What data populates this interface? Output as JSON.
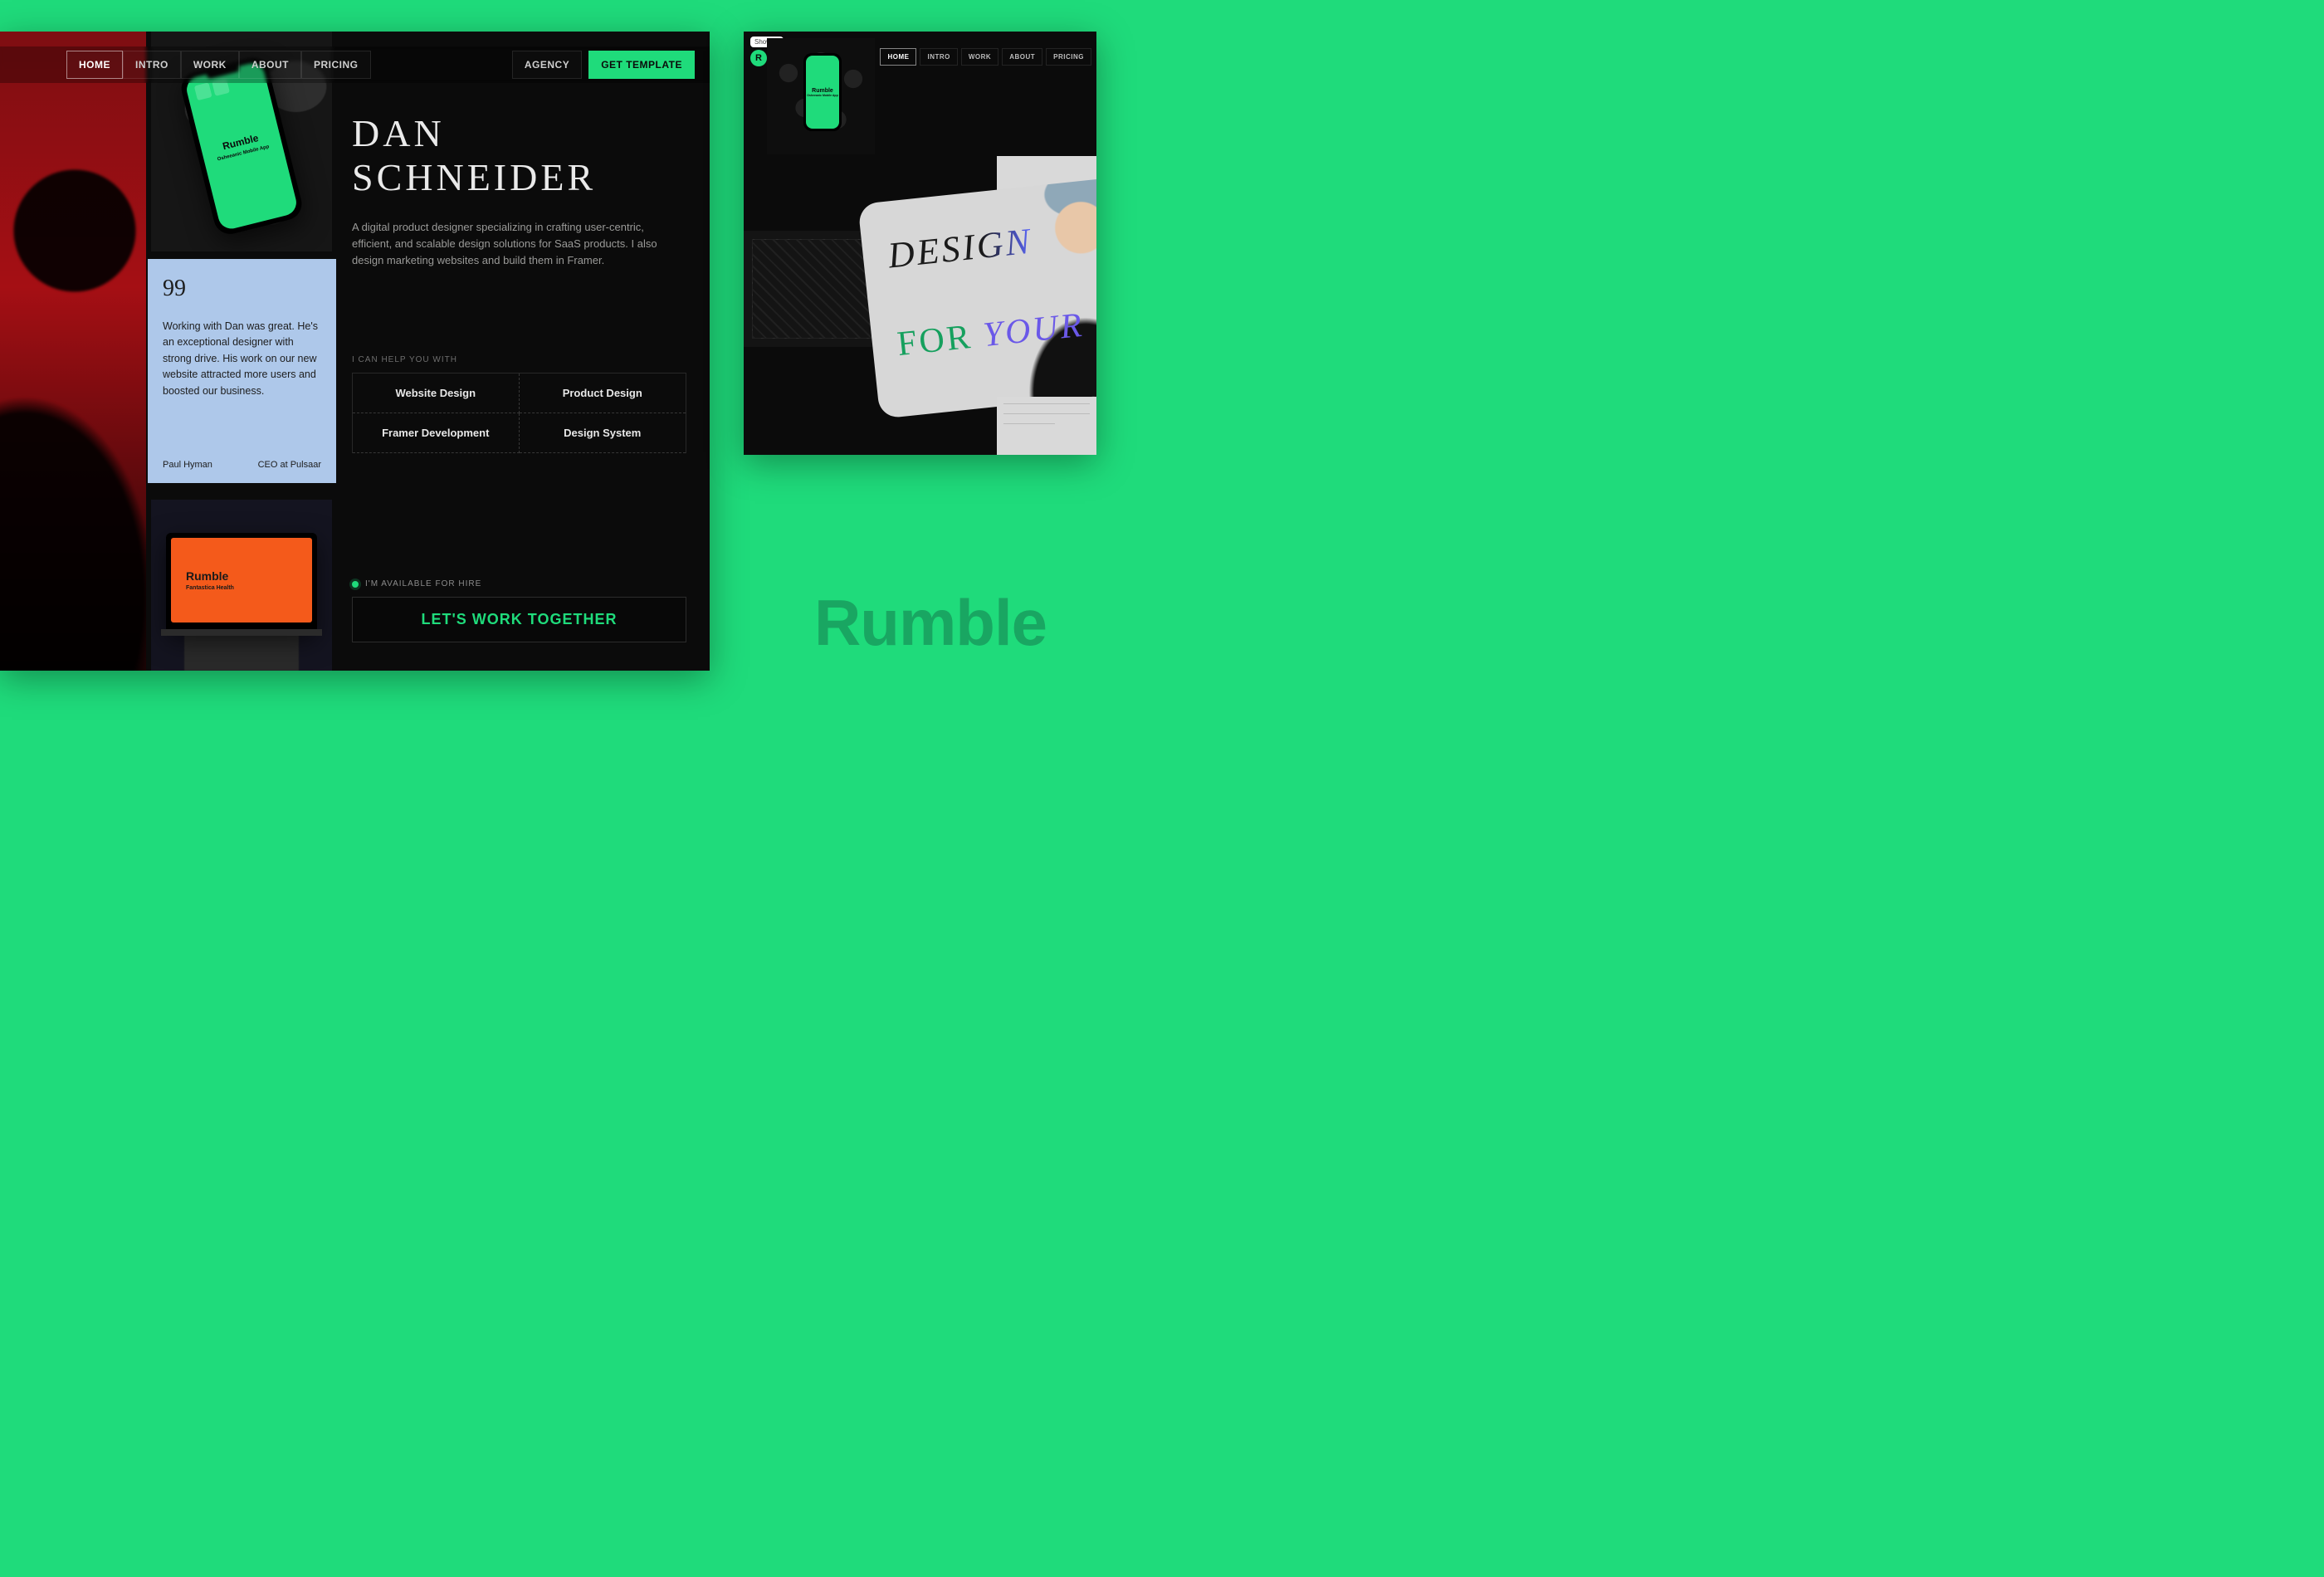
{
  "nav": {
    "items": [
      "HOME",
      "INTRO",
      "WORK",
      "ABOUT",
      "PRICING"
    ],
    "active_index": 0,
    "agency": "AGENCY",
    "get_template": "GET TEMPLATE"
  },
  "phone_mock": {
    "title": "Rumble",
    "subtitle": "Osheeanic Mobile App"
  },
  "hero": {
    "name": "DAN SCHNEIDER",
    "blurb": "A digital product designer specializing in crafting user-centric, efficient, and scalable design solutions for SaaS products. I also design marketing websites and build them in Framer."
  },
  "testimonial": {
    "quote_glyph": "99",
    "body": "Working with Dan was great. He's an exceptional designer with strong drive. His work on our new website attracted more users and boosted our business.",
    "author": "Paul Hyman",
    "role": "CEO at Pulsaar"
  },
  "help": {
    "label": "I CAN HELP YOU WITH",
    "cells": [
      "Website Design",
      "Product Design",
      "Framer Development",
      "Design System"
    ]
  },
  "laptop_mock": {
    "title": "Rumble",
    "subtitle": "Fantastica Health"
  },
  "cta": {
    "availability": "I'M AVAILABLE FOR HIRE",
    "button": "LET'S WORK TOGETHER"
  },
  "right_preview": {
    "badge": "Show UI",
    "logo_letter": "R",
    "nav_items": [
      "HOME",
      "INTRO",
      "WORK",
      "ABOUT",
      "PRICING"
    ],
    "nav_active_index": 0,
    "phone": {
      "title": "Rumble",
      "subtitle": "Osheeanic Mobile App"
    },
    "tile_label": "Rumble",
    "hero_line1": "DESIGN",
    "hero_line2_a": "FOR ",
    "hero_line2_b": "YOUR"
  },
  "brand": "Rumble"
}
